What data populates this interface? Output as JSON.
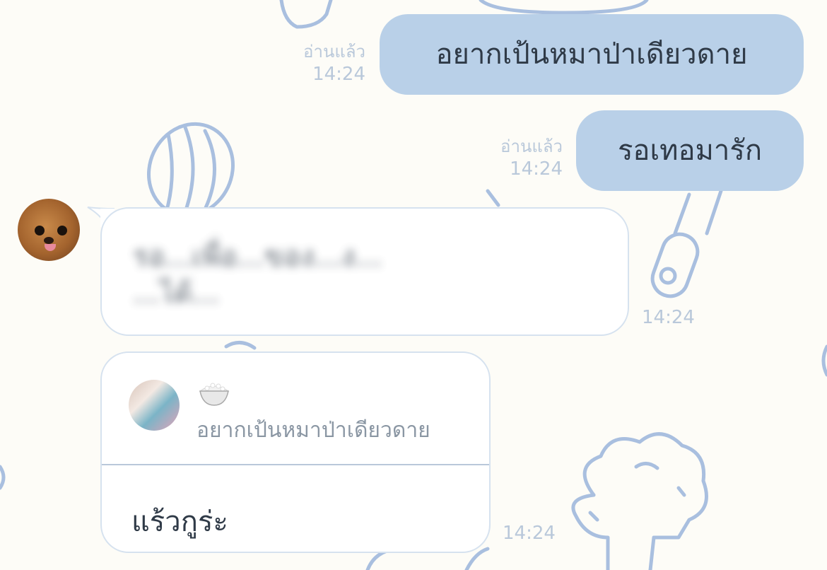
{
  "messages": [
    {
      "direction": "sent",
      "text": "อยากเป้นหมาป่าเดียวดาย",
      "status": "อ่านแล้ว",
      "time": "14:24"
    },
    {
      "direction": "sent",
      "text": "รอเทอมารัก",
      "status": "อ่านแล้ว",
      "time": "14:24"
    },
    {
      "direction": "received",
      "text_redacted": "รอ...เพื่อ...ของ...ง...\n...ได้...",
      "time": "14:24"
    },
    {
      "direction": "received",
      "quote": {
        "sender_emoji": "🍚",
        "text": "อยากเป้นหมาป่าเดียวดาย"
      },
      "text": "แร้วกูร่ะ",
      "time": "14:24"
    }
  ],
  "colors": {
    "background": "#fdfcf7",
    "sent_bubble": "#b9d0e8",
    "received_bubble": "#ffffff",
    "meta_text": "#b9c8da",
    "doodle_stroke": "#a9bfdf"
  }
}
